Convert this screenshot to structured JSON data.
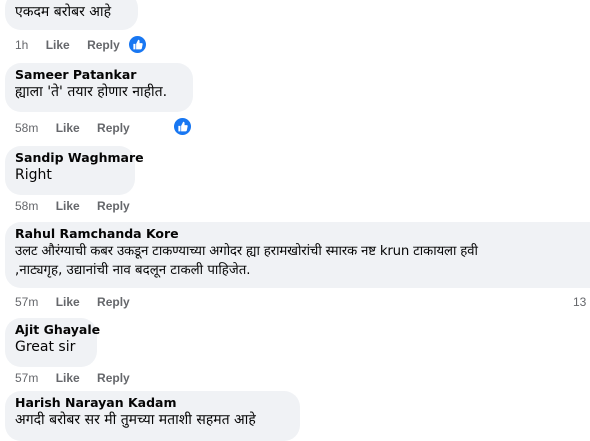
{
  "comments": [
    {
      "author": "",
      "text": "एकदम बरोबर आहे",
      "time": "1h",
      "like": "Like",
      "reply": "Reply"
    },
    {
      "author": "Sameer Patankar",
      "text": "ह्याला 'ते' तयार होणार नाहीत.",
      "time": "58m",
      "like": "Like",
      "reply": "Reply"
    },
    {
      "author": "Sandip Waghmare",
      "text": "Right",
      "time": "58m",
      "like": "Like",
      "reply": "Reply"
    },
    {
      "author": "Rahul Ramchanda Kore",
      "text": "उलट औरंग्याची कबर उकडून टाकण्याच्या अगोदर ह्या हरामखोरांची स्मारक नष्ट krun टाकायला हवी",
      "text2": ",नाट्यगृह, उद्यानांची नाव बदलून टाकली पाहिजेत.",
      "time": "57m",
      "like": "Like",
      "reply": "Reply",
      "reaction_count": "13"
    },
    {
      "author": "Ajit Ghayale",
      "text": "Great sir",
      "time": "57m",
      "like": "Like",
      "reply": "Reply"
    },
    {
      "author": "Harish Narayan Kadam",
      "text": "अगदी बरोबर सर मी तुमच्या मताशी सहमत आहे"
    }
  ],
  "colors": {
    "bubble": "#f0f2f5",
    "meta": "#65676b",
    "like_blue": "#1877f2"
  },
  "icons": [
    "thumbs-up-icon"
  ]
}
